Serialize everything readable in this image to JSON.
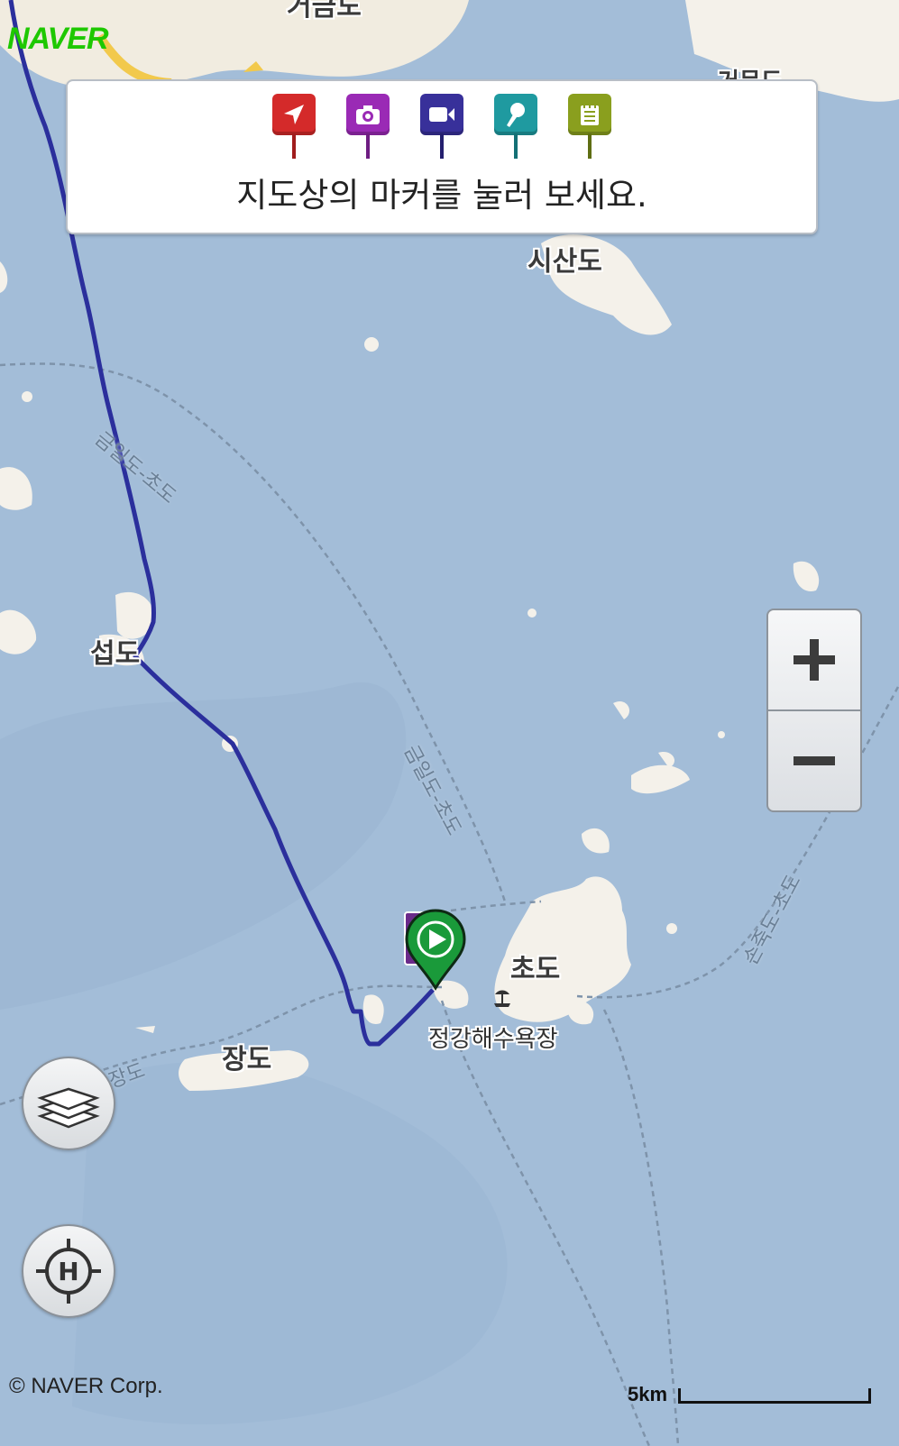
{
  "brand": {
    "logo_text": "NAVER",
    "logo_color": "#1ec800"
  },
  "legend_panel": {
    "instruction": "지도상의 마커를 눌러 보세요.",
    "markers": [
      {
        "name": "location-marker",
        "icon": "arrow-icon",
        "color": "#d42a2a"
      },
      {
        "name": "photo-marker",
        "icon": "camera-icon",
        "color": "#9a2ab5"
      },
      {
        "name": "video-marker",
        "icon": "video-camera-icon",
        "color": "#38309a"
      },
      {
        "name": "audio-marker",
        "icon": "microphone-icon",
        "color": "#1f9aa0"
      },
      {
        "name": "memo-marker",
        "icon": "notepad-icon",
        "color": "#8a9f1e"
      }
    ]
  },
  "labels": {
    "top_island": "거금도",
    "top_right_island": "거문도",
    "sisan": "시산도",
    "seop": "섭도",
    "cho": "초도",
    "beach": "정강해수욕장",
    "jang": "장도"
  },
  "ferry_routes": {
    "route_a": "금일도-초도",
    "route_b": "금일도-초도",
    "route_c": "손죽도-초도",
    "route_d": "초도-장도"
  },
  "colors": {
    "sea": "#a3bdd8",
    "land": "#f4f1ea",
    "track": "#2b2f9c",
    "start_marker": "#1a9a3a"
  },
  "controls": {
    "zoom_in": "+",
    "zoom_out": "−"
  },
  "footer": {
    "copyright": "© NAVER Corp.",
    "scale": "5km"
  }
}
